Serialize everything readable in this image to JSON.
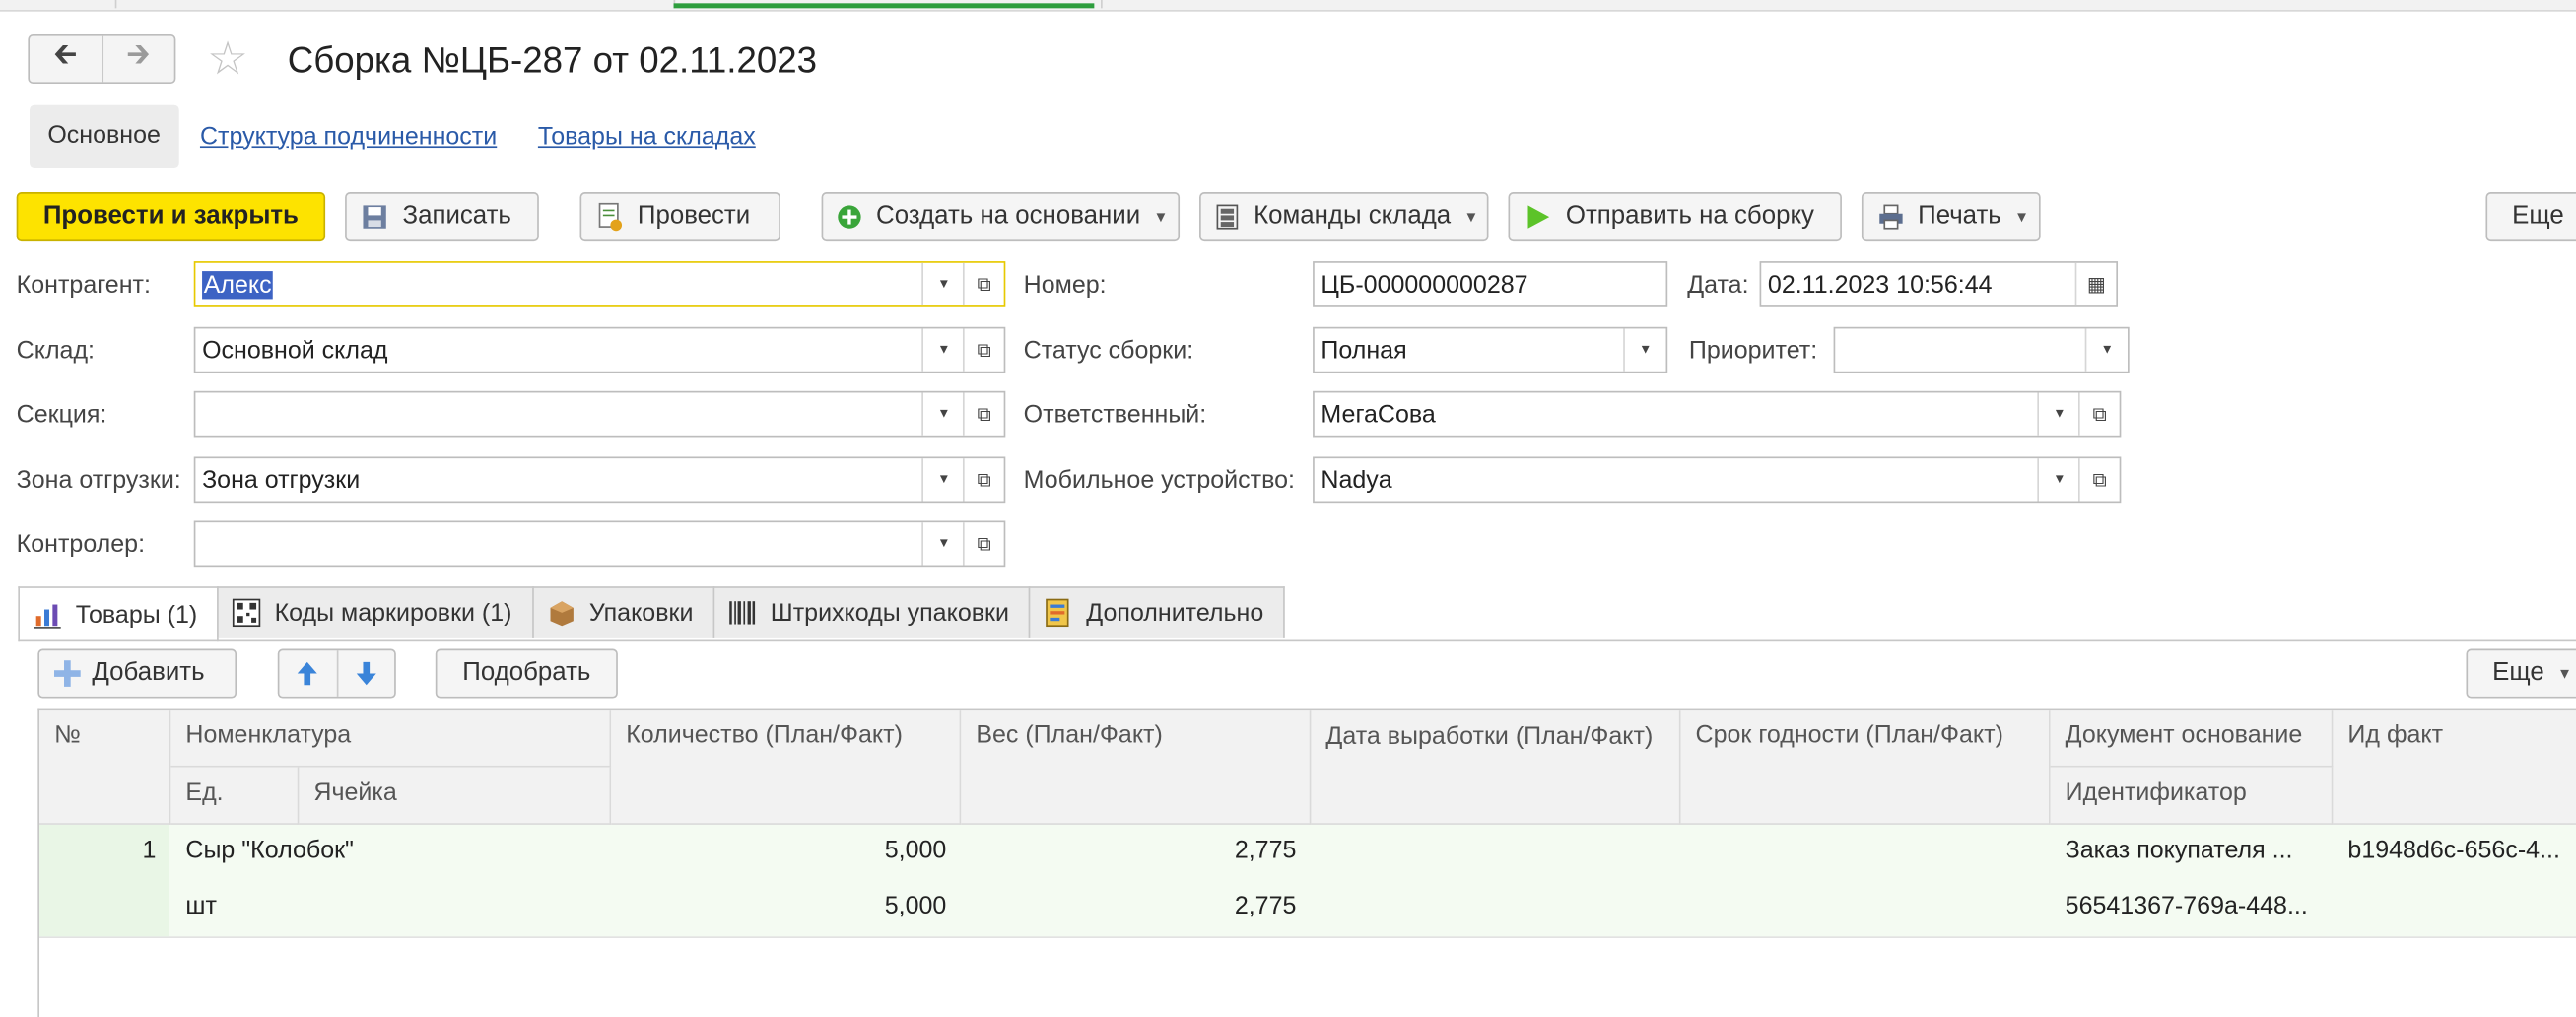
{
  "window": {
    "title": "Сборка №ЦБ-287 от 02.11.2023"
  },
  "subnav": {
    "current": "Основное",
    "links": [
      "Структура подчиненности",
      "Товары на складах"
    ]
  },
  "toolbar": {
    "post_close": "Провести и закрыть",
    "save": "Записать",
    "post": "Провести",
    "create_based": "Создать на основании",
    "warehouse_cmds": "Команды склада",
    "send_assembly": "Отправить на сборку",
    "print": "Печать",
    "more": "Еще"
  },
  "form": {
    "kontragent": {
      "label": "Контрагент:",
      "value": "Алекс"
    },
    "sklad": {
      "label": "Склад:",
      "value": "Основной склад"
    },
    "sekciya": {
      "label": "Секция:",
      "value": ""
    },
    "zona": {
      "label": "Зона отгрузки:",
      "value": "Зона отгрузки"
    },
    "kontroler": {
      "label": "Контролер:",
      "value": ""
    },
    "nomer": {
      "label": "Номер:",
      "value": "ЦБ-000000000287"
    },
    "data": {
      "label": "Дата:",
      "value": "02.11.2023 10:56:44"
    },
    "status": {
      "label": "Статус сборки:",
      "value": "Полная"
    },
    "priority": {
      "label": "Приоритет:",
      "value": ""
    },
    "otvetstv": {
      "label": "Ответственный:",
      "value": "МегаСова"
    },
    "mobile": {
      "label": "Мобильное устройство:",
      "value": "Nadya"
    }
  },
  "tabs": [
    "Товары (1)",
    "Коды маркировки  (1)",
    "Упаковки",
    "Штрихкоды упаковки",
    "Дополнительно"
  ],
  "table_toolbar": {
    "add": "Добавить",
    "pick": "Подобрать",
    "more": "Еще"
  },
  "table": {
    "headers": {
      "num": "№",
      "nomenklatura": "Номенклатура",
      "ed": "Ед.",
      "yacheika": "Ячейка",
      "qty": "Количество (План/Факт)",
      "weight": "Вес (План/Факт)",
      "date_made": "Дата выработки (План/Факт)",
      "expiry": "Срок годности  (План/Факт)",
      "doc": "Документ основание",
      "ident": "Идентификатор",
      "id_fact": "Ид факт"
    },
    "rows": [
      {
        "num": "1",
        "name": "Сыр \"Колобок\"",
        "unit": "шт",
        "qty_plan": "5,000",
        "qty_fact": "5,000",
        "weight_plan": "2,775",
        "weight_fact": "2,775",
        "doc": "Заказ покупателя ...",
        "ident": "56541367-769a-448...",
        "id_fact": "b1948d6c-656c-4..."
      }
    ]
  }
}
